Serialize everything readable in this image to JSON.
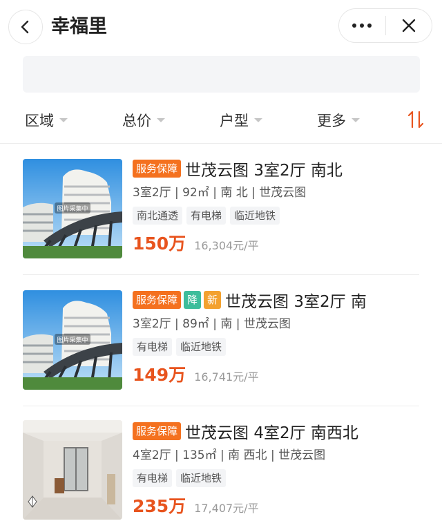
{
  "header": {
    "title": "幸福里"
  },
  "search": {
    "placeholder": ""
  },
  "filters": [
    {
      "label": "区域"
    },
    {
      "label": "总价"
    },
    {
      "label": "户型"
    },
    {
      "label": "更多"
    }
  ],
  "colors": {
    "accent": "#e8541e",
    "badge_service": "#f4711f",
    "badge_drop": "#3dbd9b",
    "badge_new": "#f3a12f"
  },
  "listings": [
    {
      "badges": [
        "服务保障"
      ],
      "title": "世茂云图 3室2厅 南北",
      "meta": "3室2厅 | 92㎡ | 南 北 | 世茂云图",
      "tags": [
        "南北通透",
        "有电梯",
        "临近地铁"
      ],
      "price": "150万",
      "unit_price": "16,304元/平",
      "thumb_caption": "图片采集中"
    },
    {
      "badges": [
        "服务保障",
        "降",
        "新"
      ],
      "title": "世茂云图 3室2厅 南",
      "meta": "3室2厅 | 89㎡ | 南 | 世茂云图",
      "tags": [
        "有电梯",
        "临近地铁"
      ],
      "price": "149万",
      "unit_price": "16,741元/平",
      "thumb_caption": "图片采集中"
    },
    {
      "badges": [
        "服务保障"
      ],
      "title": "世茂云图 4室2厅 南西北",
      "meta": "4室2厅 | 135㎡ | 南 西北 | 世茂云图",
      "tags": [
        "有电梯",
        "临近地铁"
      ],
      "price": "235万",
      "unit_price": "17,407元/平"
    }
  ]
}
